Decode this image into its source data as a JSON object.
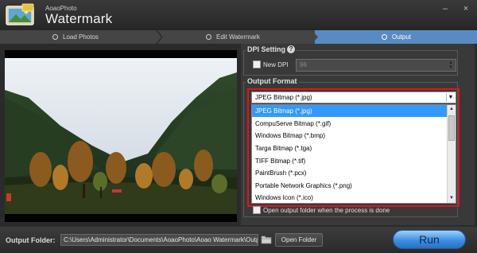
{
  "window": {
    "app_name_small": "AoaoPhoto",
    "app_name_big": "Watermark",
    "minimize_glyph": "–",
    "close_glyph": "×"
  },
  "steps": [
    {
      "label": "Load Photos",
      "active": false
    },
    {
      "label": "Edit Watermark",
      "active": false
    },
    {
      "label": "Output",
      "active": true
    }
  ],
  "dpi": {
    "group_label": "DPI Setting",
    "help_glyph": "?",
    "new_dpi_label": "New DPI",
    "new_dpi_checked": false,
    "new_dpi_value": "96"
  },
  "output_format": {
    "group_label": "Output Format",
    "selected": "JPEG Bitmap (*.jpg)",
    "options": [
      "JPEG Bitmap (*.jpg)",
      "CompuServe Bitmap (*.gif)",
      "Windows Bitmap (*.bmp)",
      "Targa Bitmap (*.tga)",
      "TIFF Bitmap (*.tif)",
      "PaintBrush (*.pcx)",
      "Portable Network Graphics (*.png)",
      "Windows Icon (*.ico)"
    ],
    "highlighted_index": 0
  },
  "open_folder_option": {
    "label": "Open output folder when the process is done",
    "checked": false
  },
  "bottom": {
    "output_folder_label": "Output Folder:",
    "output_folder_path": "C:\\Users\\Administrator\\Documents\\AoaoPhoto\\Aoao Watermark\\Outp",
    "open_folder_button": "Open Folder",
    "run_button": "Run"
  },
  "colors": {
    "accent_step": "#5a8ac2",
    "highlight_frame": "#e0141e",
    "selection": "#3399ff",
    "run_button": "#3d8fe0"
  },
  "icons": [
    "app-logo-icon",
    "help-icon",
    "folder-icon",
    "chevron-down-icon",
    "minimize-icon",
    "close-icon"
  ]
}
